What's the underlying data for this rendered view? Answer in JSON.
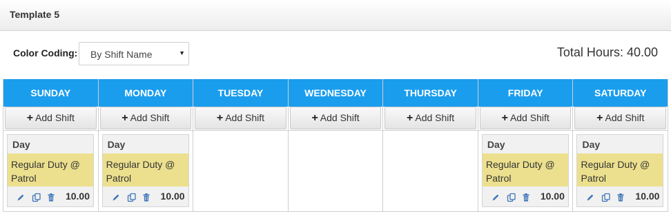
{
  "header": {
    "title": "Template 5"
  },
  "toolbar": {
    "color_coding_label": "Color Coding:",
    "color_coding_value": "By Shift Name",
    "total_hours_label": "Total Hours:",
    "total_hours_value": "40.00"
  },
  "add_shift_label": "Add Shift",
  "colors": {
    "header_blue": "#1a9ded",
    "shift_yellow": "#ece08e",
    "icon_blue": "#3c74b8"
  },
  "days": [
    {
      "name": "SUNDAY",
      "shift": {
        "type": "Day",
        "name": "Regular Duty @ Patrol",
        "hours": "10.00"
      }
    },
    {
      "name": "MONDAY",
      "shift": {
        "type": "Day",
        "name": "Regular Duty @ Patrol",
        "hours": "10.00"
      }
    },
    {
      "name": "TUESDAY",
      "shift": null
    },
    {
      "name": "WEDNESDAY",
      "shift": null
    },
    {
      "name": "THURSDAY",
      "shift": null
    },
    {
      "name": "FRIDAY",
      "shift": {
        "type": "Day",
        "name": "Regular Duty @ Patrol",
        "hours": "10.00"
      }
    },
    {
      "name": "SATURDAY",
      "shift": {
        "type": "Day",
        "name": "Regular Duty @ Patrol",
        "hours": "10.00"
      }
    }
  ]
}
